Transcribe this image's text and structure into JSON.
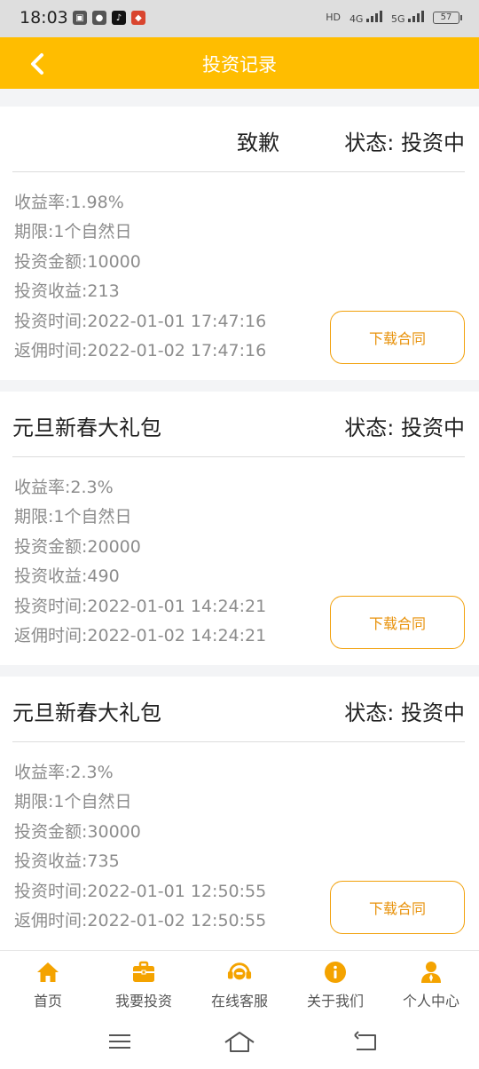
{
  "status_bar": {
    "time": "18:03",
    "battery": "57",
    "network_1": "4G",
    "network_2": "5G",
    "hd": "HD"
  },
  "header": {
    "title": "投资记录"
  },
  "records": [
    {
      "title": "致歉",
      "status": "状态: 投资中",
      "rate": "收益率:1.98%",
      "period": "期限:1个自然日",
      "amount": "投资金额:10000",
      "income": "投资收益:213",
      "invest_time": "投资时间:2022-01-01 17:47:16",
      "return_time": "返佣时间:2022-01-02 17:47:16",
      "button": "下载合同"
    },
    {
      "title": "元旦新春大礼包",
      "status": "状态: 投资中",
      "rate": "收益率:2.3%",
      "period": "期限:1个自然日",
      "amount": "投资金额:20000",
      "income": "投资收益:490",
      "invest_time": "投资时间:2022-01-01 14:24:21",
      "return_time": "返佣时间:2022-01-02 14:24:21",
      "button": "下载合同"
    },
    {
      "title": "元旦新春大礼包",
      "status": "状态: 投资中",
      "rate": "收益率:2.3%",
      "period": "期限:1个自然日",
      "amount": "投资金额:30000",
      "income": "投资收益:735",
      "invest_time": "投资时间:2022-01-01 12:50:55",
      "return_time": "返佣时间:2022-01-02 12:50:55",
      "button": "下载合同"
    }
  ],
  "tabbar": {
    "items": [
      {
        "label": "首页",
        "icon": "home-icon"
      },
      {
        "label": "我要投资",
        "icon": "briefcase-icon"
      },
      {
        "label": "在线客服",
        "icon": "headset-icon"
      },
      {
        "label": "关于我们",
        "icon": "info-icon"
      },
      {
        "label": "个人中心",
        "icon": "user-icon"
      }
    ]
  },
  "colors": {
    "accent": "#ffbd00",
    "button_border": "#f2a00a",
    "button_text": "#e8920b",
    "tab_icon": "#f4a300"
  }
}
